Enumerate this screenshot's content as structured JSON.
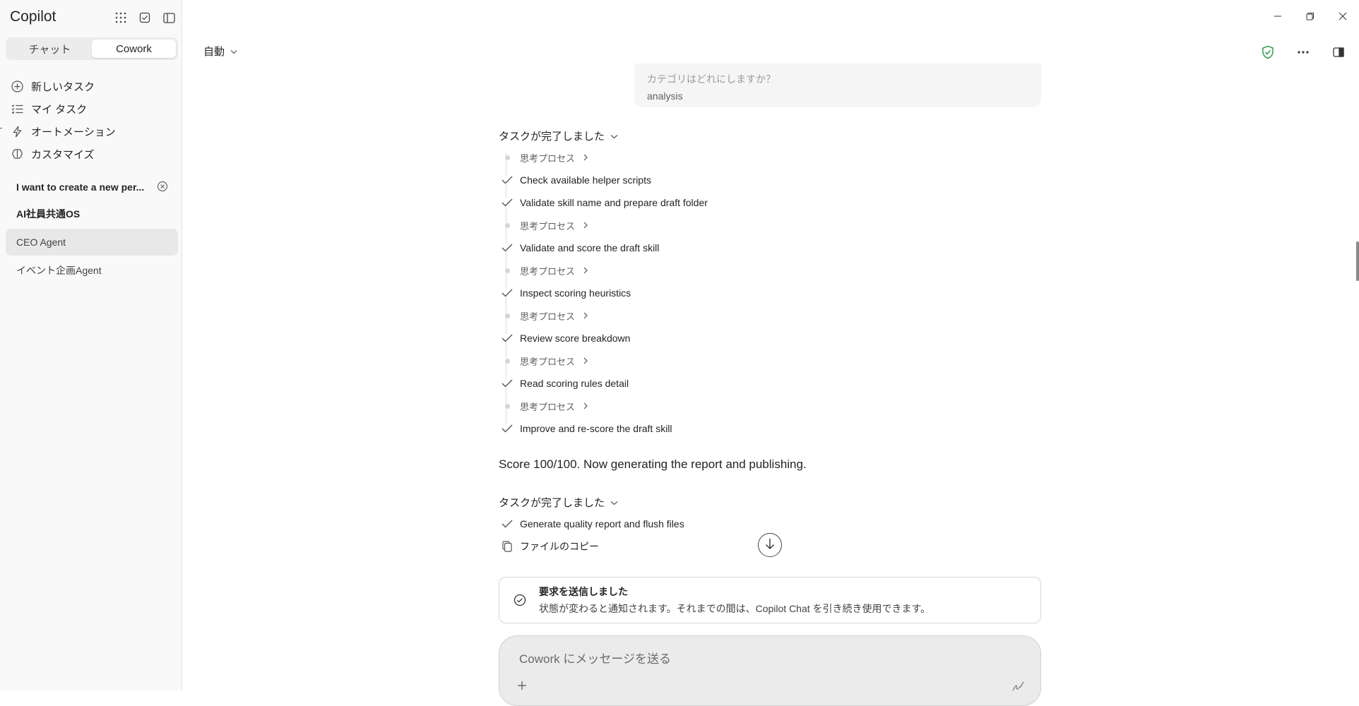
{
  "sidebar": {
    "app_title": "Copilot",
    "tabs": [
      {
        "label": "チャット",
        "active": false
      },
      {
        "label": "Cowork",
        "active": true
      }
    ],
    "nav": [
      {
        "label": "新しいタスク",
        "icon": "plus-circle-icon"
      },
      {
        "label": "マイ タスク",
        "icon": "task-list-icon"
      },
      {
        "label": "オートメーション",
        "icon": "lightning-icon"
      },
      {
        "label": "カスタマイズ",
        "icon": "brain-icon"
      }
    ],
    "recent": [
      {
        "label": "I want to create a new per...",
        "bold": true
      },
      {
        "label": "AI社員共通OS",
        "bold": true
      },
      {
        "label": "CEO Agent",
        "selected": true
      },
      {
        "label": "イベント企画Agent"
      }
    ]
  },
  "toolbar": {
    "model_label": "自動"
  },
  "conversation": {
    "prev_question": "カテゴリはどれにしますか？",
    "prev_answer": "analysis",
    "task1": {
      "header": "タスクが完了しました",
      "steps": [
        {
          "type": "thought",
          "label": "思考プロセス"
        },
        {
          "type": "done",
          "label": "Check available helper scripts"
        },
        {
          "type": "done",
          "label": "Validate skill name and prepare draft folder"
        },
        {
          "type": "thought",
          "label": "思考プロセス"
        },
        {
          "type": "done",
          "label": "Validate and score the draft skill"
        },
        {
          "type": "thought",
          "label": "思考プロセス"
        },
        {
          "type": "done",
          "label": "Inspect scoring heuristics"
        },
        {
          "type": "thought",
          "label": "思考プロセス"
        },
        {
          "type": "done",
          "label": "Review score breakdown"
        },
        {
          "type": "thought",
          "label": "思考プロセス"
        },
        {
          "type": "done",
          "label": "Read scoring rules detail"
        },
        {
          "type": "thought",
          "label": "思考プロセス"
        },
        {
          "type": "done",
          "label": "Improve and re-score the draft skill"
        }
      ]
    },
    "score_message": "Score 100/100. Now generating the report and publishing.",
    "task2": {
      "header": "タスクが完了しました",
      "steps": [
        {
          "type": "done",
          "label": "Generate quality report and flush files"
        },
        {
          "type": "file",
          "label": "ファイルのコピー"
        }
      ]
    }
  },
  "notice": {
    "title": "要求を送信しました",
    "description": "状態が変わると通知されます。それまでの間は、Copilot Chat を引き続き使用できます。"
  },
  "composer": {
    "placeholder": "Cowork にメッセージを送る",
    "value": ""
  },
  "colors": {
    "shield_green": "#2e9d4f",
    "sidebar_bg": "#f9f9f9",
    "selected_bg": "#e8e8e8"
  }
}
